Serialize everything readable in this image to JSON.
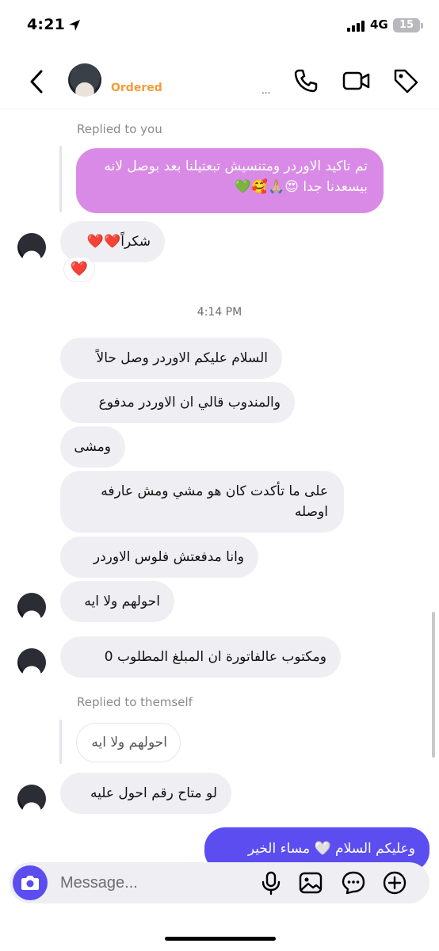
{
  "status_bar": {
    "time": "4:21",
    "network": "4G",
    "battery": "15"
  },
  "header": {
    "contact_name": "Ordered",
    "contact_suffix": "...",
    "icons": [
      "back-icon",
      "phone-icon",
      "video-icon",
      "tag-icon"
    ]
  },
  "chat": {
    "reply_label_1": "Replied to you",
    "quoted_message_1": "تم تاكيد الاوردر ومتنسيش تبعتيلنا بعد بوصل لانه بيسعدنا جدا 😍🙏🏼🥰💚",
    "thanks_message": "شكراً❤️❤️",
    "reaction": "❤️",
    "timestamp": "4:14 PM",
    "messages": [
      "السلام عليكم الاوردر وصل حالاً",
      "والمندوب قالي ان الاوردر مدفوع",
      "ومشى",
      "على ما تأكدت كان هو مشي ومش عارفه اوصله",
      "وانا مدفعتش فلوس الاوردر",
      "احولهم ولا ايه",
      "ومكتوب عالفاتورة ان المبلغ المطلوب 0"
    ],
    "reply_label_2": "Replied to themself",
    "quoted_message_2": "احولهم ولا ايه",
    "last_incoming": "لو متاح رقم احول عليه",
    "outgoing_message": "وعليكم السلام 🤍 مساء الخير"
  },
  "composer": {
    "placeholder": "Message..."
  },
  "colors": {
    "accent": "#5b4df0",
    "quoted_bubble": "#d98ae6",
    "incoming_bubble": "#efeff3"
  }
}
